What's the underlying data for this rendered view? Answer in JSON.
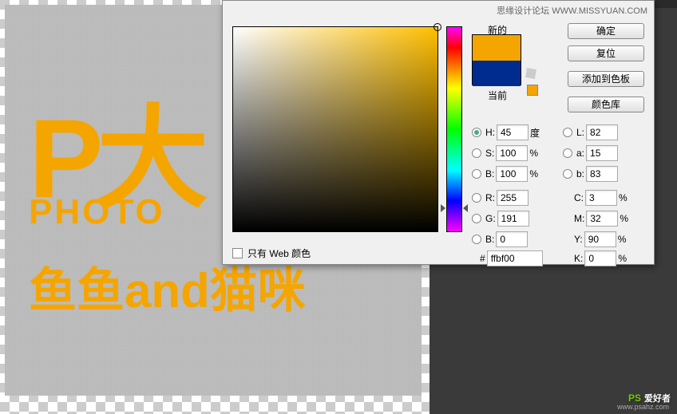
{
  "canvas": {
    "line1": "P大",
    "line2": "PHOTO",
    "line3": "鱼鱼and猫咪"
  },
  "picker": {
    "newLabel": "新的",
    "currentLabel": "当前",
    "buttons": {
      "ok": "确定",
      "reset": "复位",
      "addSwatch": "添加到色板",
      "colorLib": "颜色库"
    },
    "hsb": {
      "h": {
        "label": "H:",
        "value": "45",
        "unit": "度"
      },
      "s": {
        "label": "S:",
        "value": "100",
        "unit": "%"
      },
      "b": {
        "label": "B:",
        "value": "100",
        "unit": "%"
      }
    },
    "rgb": {
      "r": {
        "label": "R:",
        "value": "255"
      },
      "g": {
        "label": "G:",
        "value": "191"
      },
      "b": {
        "label": "B:",
        "value": "0"
      }
    },
    "lab": {
      "l": {
        "label": "L:",
        "value": "82"
      },
      "a": {
        "label": "a:",
        "value": "15"
      },
      "b": {
        "label": "b:",
        "value": "83"
      }
    },
    "cmyk": {
      "c": {
        "label": "C:",
        "value": "3",
        "unit": "%"
      },
      "m": {
        "label": "M:",
        "value": "32",
        "unit": "%"
      },
      "y": {
        "label": "Y:",
        "value": "90",
        "unit": "%"
      },
      "k": {
        "label": "K:",
        "value": "0",
        "unit": "%"
      }
    },
    "hex": {
      "label": "#",
      "value": "ffbf00"
    },
    "webOnly": "只有 Web 颜色"
  },
  "watermarks": {
    "top": "思缘设计论坛  WWW.MISSYUAN.COM",
    "logo": "PS",
    "logoTag": "爱好者",
    "logoUrl": "www.psahz.com"
  },
  "colors": {
    "new": "#f5a500",
    "current": "#002b8f"
  }
}
